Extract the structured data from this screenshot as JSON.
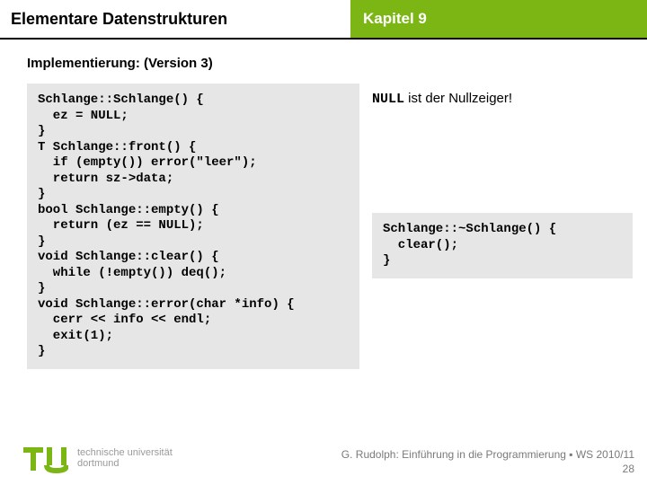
{
  "header": {
    "left": "Elementare Datenstrukturen",
    "right": "Kapitel 9"
  },
  "subtitle": "Implementierung: (Version 3)",
  "code_main": "Schlange::Schlange() {\n  ez = NULL;\n}\nT Schlange::front() {\n  if (empty()) error(\"leer\");\n  return sz->data;\n}\nbool Schlange::empty() {\n  return (ez == NULL);\n}\nvoid Schlange::clear() {\n  while (!empty()) deq();\n}\nvoid Schlange::error(char *info) {\n  cerr << info << endl;\n  exit(1);\n}",
  "null_keyword": "NULL",
  "null_note_rest": " ist der Nullzeiger!",
  "code_dtor": "Schlange::~Schlange() {\n  clear();\n}",
  "logo": {
    "line1": "technische universität",
    "line2": "dortmund"
  },
  "footer": {
    "line1": "G. Rudolph: Einführung in die Programmierung ▪ WS 2010/11",
    "line2": "28"
  }
}
